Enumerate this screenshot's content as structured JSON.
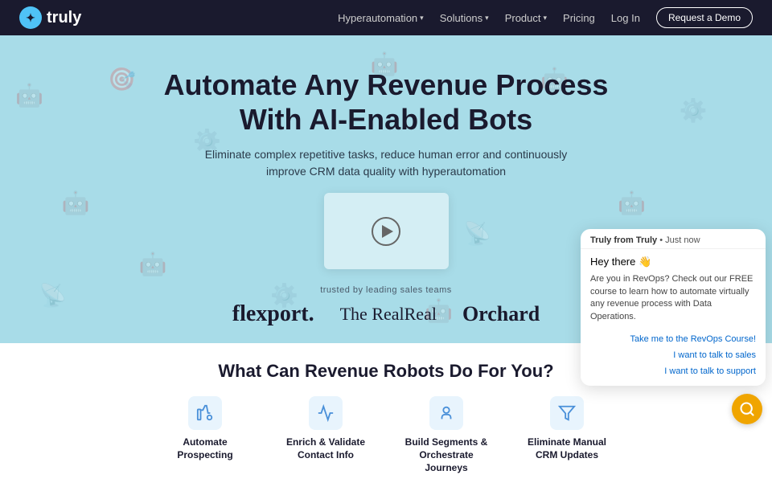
{
  "navbar": {
    "logo_text": "truly",
    "nav_items": [
      {
        "label": "Hyperautomation",
        "has_dropdown": true
      },
      {
        "label": "Solutions",
        "has_dropdown": true
      },
      {
        "label": "Product",
        "has_dropdown": true
      },
      {
        "label": "Pricing",
        "has_dropdown": false
      }
    ],
    "login_label": "Log In",
    "cta_label": "Request a Demo"
  },
  "hero": {
    "title_line1": "Automate Any Revenue Process",
    "title_line2": "With AI-Enabled Bots",
    "subtitle": "Eliminate complex repetitive tasks, reduce human error and continuously\nimprove CRM data quality with hyperautomation"
  },
  "trusted": {
    "label": "trusted by leading sales teams",
    "logos": [
      "flexport.",
      "The RealReal",
      "Orchard"
    ]
  },
  "what_section": {
    "title": "What Can Revenue Robots Do For You?",
    "features": [
      {
        "label": "Automate Prospecting",
        "icon": "💼"
      },
      {
        "label": "Enrich & Validate Contact Info",
        "icon": "📊"
      },
      {
        "label": "Build Segments & Orchestrate Journeys",
        "icon": "👤"
      },
      {
        "label": "Eliminate Manual CRM Updates",
        "icon": "🔧"
      }
    ]
  },
  "chat": {
    "header": "Truly from Truly • Just now",
    "greeting": "Hey there 👋",
    "message": "Are you in RevOps?  Check out our FREE course to learn how to automate virtually any revenue process with Data Operations.",
    "actions": [
      "Take me to the RevOps Course!",
      "I want to talk to sales",
      "I want to talk to support"
    ]
  }
}
